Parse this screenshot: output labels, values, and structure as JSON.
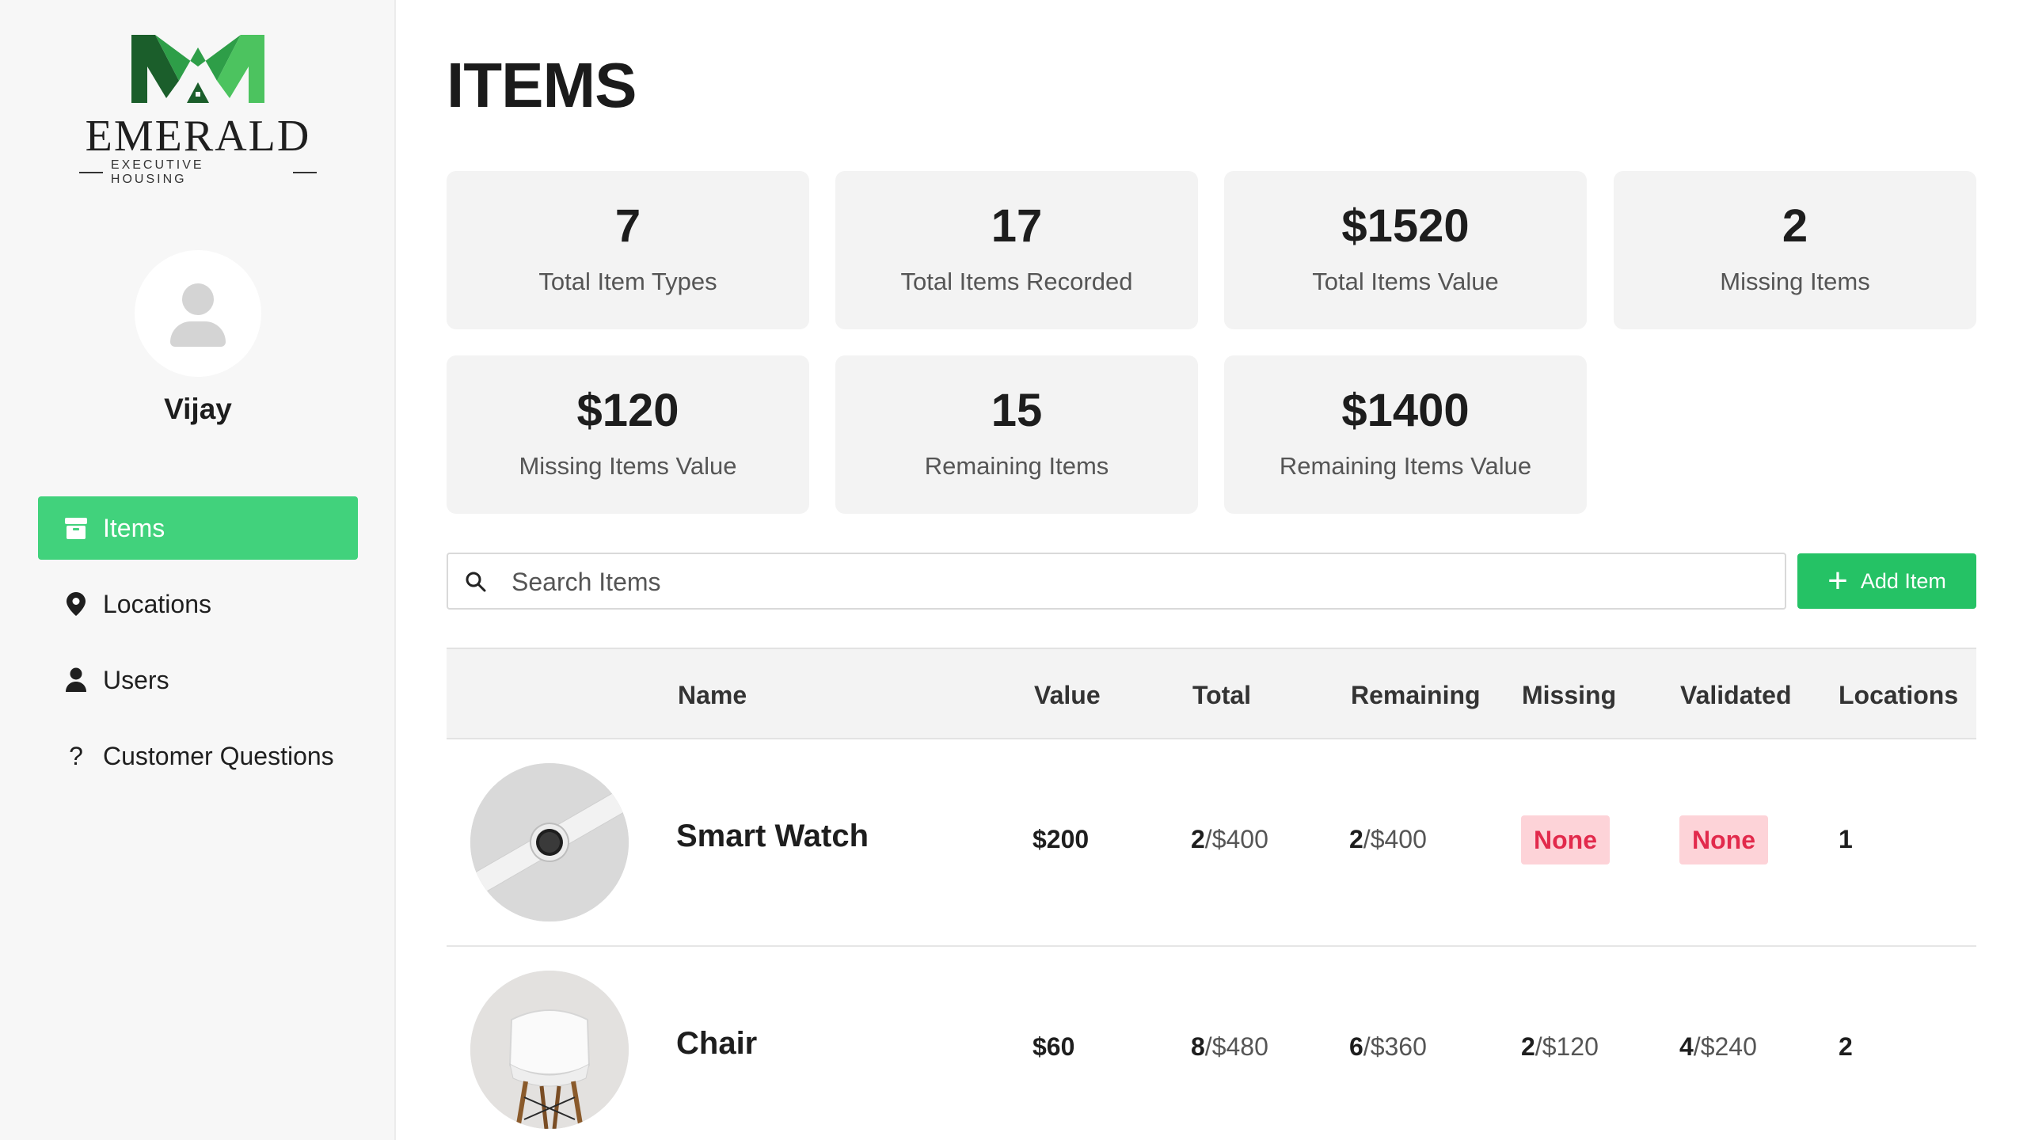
{
  "brand": {
    "name": "EMERALD",
    "tagline": "EXECUTIVE HOUSING",
    "colors": {
      "dark": "#1b5e2b",
      "mid": "#2e9e48",
      "light": "#4cc35f"
    }
  },
  "user": {
    "name": "Vijay"
  },
  "nav": [
    {
      "label": "Items",
      "icon": "box-icon",
      "active": true
    },
    {
      "label": "Locations",
      "icon": "map-pin-icon",
      "active": false
    },
    {
      "label": "Users",
      "icon": "user-icon",
      "active": false
    },
    {
      "label": "Customer Questions",
      "icon": "question-icon",
      "active": false
    }
  ],
  "page": {
    "title": "ITEMS"
  },
  "stats": [
    {
      "value": "7",
      "label": "Total Item Types"
    },
    {
      "value": "17",
      "label": "Total Items Recorded"
    },
    {
      "value": "$1520",
      "label": "Total Items Value"
    },
    {
      "value": "2",
      "label": "Missing Items"
    },
    {
      "value": "$120",
      "label": "Missing Items Value"
    },
    {
      "value": "15",
      "label": "Remaining Items"
    },
    {
      "value": "$1400",
      "label": "Remaining Items Value"
    }
  ],
  "search": {
    "placeholder": "Search Items",
    "value": ""
  },
  "actions": {
    "add_label": "Add Item"
  },
  "table": {
    "headers": [
      "Name",
      "Value",
      "Total",
      "Remaining",
      "Missing",
      "Validated",
      "Locations"
    ],
    "rows": [
      {
        "name": "Smart Watch",
        "image": "smart-watch-image",
        "value": "$200",
        "total_count": "2",
        "total_value": "/$400",
        "remaining_count": "2",
        "remaining_value": "/$400",
        "missing": "None",
        "validated": "None",
        "locations": "1"
      },
      {
        "name": "Chair",
        "image": "chair-image",
        "value": "$60",
        "total_count": "8",
        "total_value": "/$480",
        "remaining_count": "6",
        "remaining_value": "/$360",
        "missing_count": "2",
        "missing_value": "/$120",
        "validated_count": "4",
        "validated_value": "/$240",
        "locations": "2"
      }
    ]
  },
  "colors": {
    "accent": "#41d27c",
    "button": "#25c265",
    "badge_bg": "#fdd3d8",
    "badge_text": "#e22a4c"
  }
}
